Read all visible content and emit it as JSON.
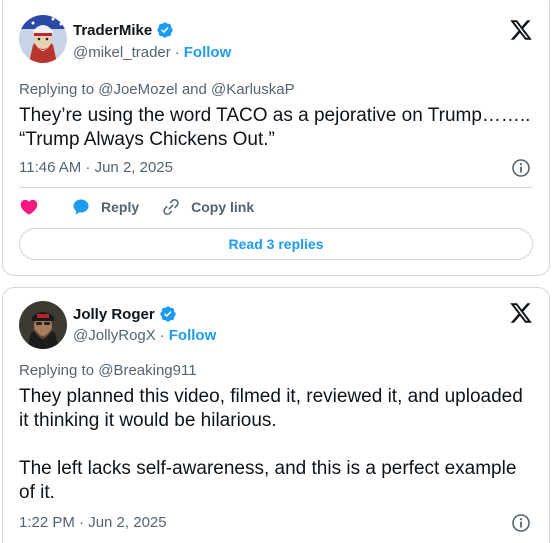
{
  "tweets": [
    {
      "author_name": "TraderMike",
      "handle": "@mikel_trader",
      "follow_label": "Follow",
      "replying_prefix": "Replying to ",
      "replying_to_1": "@JoeMozel",
      "replying_and": " and ",
      "replying_to_2": "@KarluskaP",
      "text": "They’re using the word TACO as a pejorative on Trump…….. “Trump Always Chickens Out.”",
      "timestamp": "11:46 AM · Jun 2, 2025",
      "reply_label": "Reply",
      "copy_link_label": "Copy link",
      "read_replies_label": "Read 3 replies"
    },
    {
      "author_name": "Jolly Roger",
      "handle": "@JollyRogX",
      "follow_label": "Follow",
      "replying_prefix": "Replying to ",
      "replying_to_1": "@Breaking911",
      "text": "They planned this video, filmed it, reviewed it, and uploaded it thinking it would be hilarious.\n\nThe left lacks self-awareness, and this is a perfect example of it.",
      "timestamp": "1:22 PM · Jun 2, 2025"
    }
  ],
  "colors": {
    "accent": "#1d9bf0",
    "secondary_text": "#536471",
    "heart": "#f91880",
    "border": "#cfd9de"
  },
  "icons": [
    "verified-badge-icon",
    "x-logo-icon",
    "info-icon",
    "heart-icon",
    "reply-bubble-icon",
    "link-icon"
  ]
}
